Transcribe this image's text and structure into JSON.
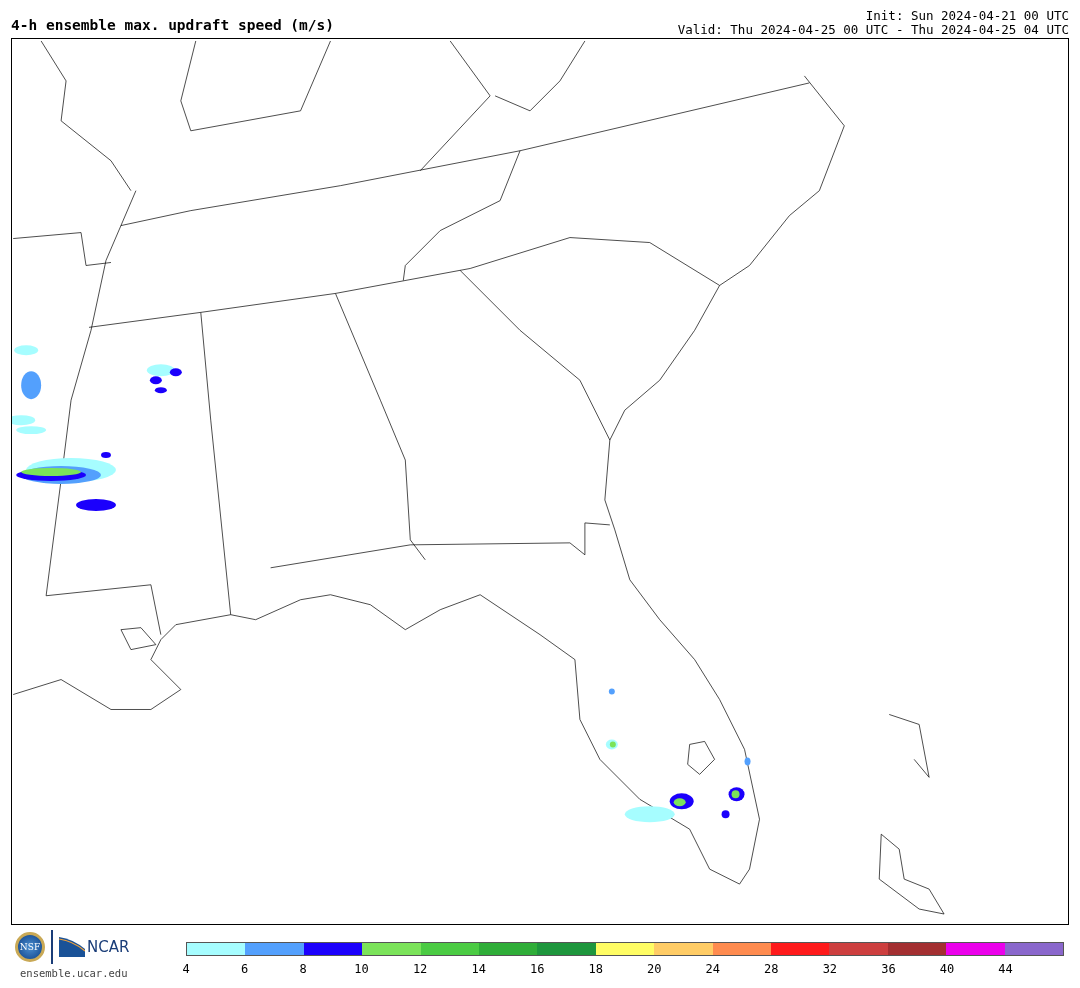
{
  "title": "4-h ensemble max. updraft speed (m/s)",
  "init": "Init: Sun 2024-04-21 00 UTC",
  "valid": "Valid: Thu 2024-04-25 00 UTC - Thu 2024-04-25 04 UTC",
  "logos": {
    "nsf": "NSF",
    "ncar": "NCAR",
    "url": "ensemble.ucar.edu"
  },
  "colorbar": {
    "bins": [
      {
        "color": "#a6fdff"
      },
      {
        "color": "#53a0fd"
      },
      {
        "color": "#1b00fc"
      },
      {
        "color": "#7be35a"
      },
      {
        "color": "#4bcb43"
      },
      {
        "color": "#2fad38"
      },
      {
        "color": "#1e963d"
      },
      {
        "color": "#fffd64"
      },
      {
        "color": "#ffcc66"
      },
      {
        "color": "#fe8b4f"
      },
      {
        "color": "#fe1a1b"
      },
      {
        "color": "#cd3f3f"
      },
      {
        "color": "#a32f31"
      },
      {
        "color": "#eb00eb"
      },
      {
        "color": "#8a67cc"
      }
    ],
    "ticks": [
      "4",
      "6",
      "8",
      "10",
      "12",
      "14",
      "16",
      "18",
      "20",
      "24",
      "28",
      "32",
      "36",
      "40",
      "44"
    ]
  }
}
